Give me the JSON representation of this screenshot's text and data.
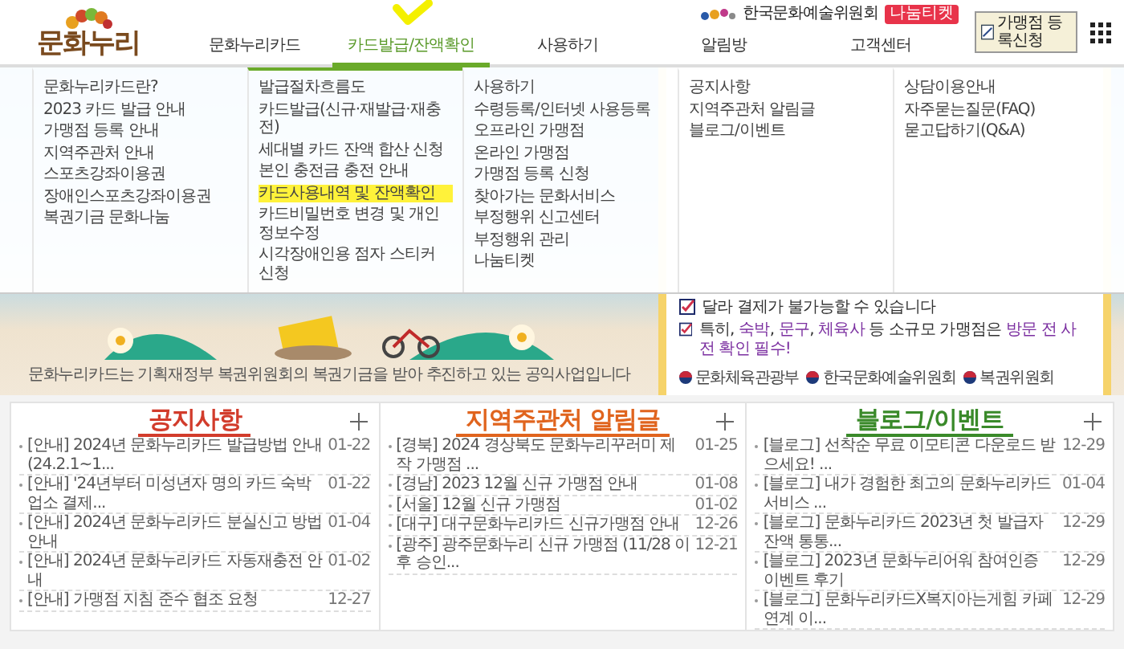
{
  "header": {
    "logo": "문화누리",
    "partner": "한국문화예술위원회",
    "ticket_badge": "나눔티켓",
    "register_button": "가맹점 등록신청",
    "nav": [
      {
        "label": "문화누리카드",
        "selected": false
      },
      {
        "label": "카드발급/잔액확인",
        "selected": true
      },
      {
        "label": "사용하기",
        "selected": false
      },
      {
        "label": "알림방",
        "selected": false
      },
      {
        "label": "고객센터",
        "selected": false
      }
    ]
  },
  "mega_menu": {
    "columns": [
      {
        "items": [
          {
            "label": "문화누리카드란?",
            "highlighted": false
          },
          {
            "label": "2023 카드 발급 안내",
            "highlighted": false
          },
          {
            "label": "가맹점 등록 안내",
            "highlighted": false
          },
          {
            "label": "지역주관처 안내",
            "highlighted": false
          },
          {
            "label": "스포츠강좌이용권",
            "highlighted": false
          },
          {
            "label": "장애인스포츠강좌이용권",
            "highlighted": false
          },
          {
            "label": "복권기금 문화나눔",
            "highlighted": false
          }
        ]
      },
      {
        "items": [
          {
            "label": "발급절차흐름도",
            "highlighted": false
          },
          {
            "label": "카드발급(신규·재발급·재충전)",
            "highlighted": false
          },
          {
            "label": "세대별 카드 잔액 합산 신청",
            "highlighted": false
          },
          {
            "label": "본인 충전금 충전 안내",
            "highlighted": false
          },
          {
            "label": "카드사용내역 및 잔액확인",
            "highlighted": true
          },
          {
            "label": "카드비밀번호 변경 및 개인정보수정",
            "highlighted": false
          },
          {
            "label": "시각장애인용 점자 스티커 신청",
            "highlighted": false
          }
        ]
      },
      {
        "items": [
          {
            "label": "사용하기",
            "highlighted": false
          },
          {
            "label": "수령등록/인터넷 사용등록",
            "highlighted": false
          },
          {
            "label": "오프라인 가맹점",
            "highlighted": false
          },
          {
            "label": "온라인 가맹점",
            "highlighted": false
          },
          {
            "label": "가맹점 등록 신청",
            "highlighted": false
          },
          {
            "label": "찾아가는 문화서비스",
            "highlighted": false
          },
          {
            "label": "부정행위 신고센터",
            "highlighted": false
          },
          {
            "label": "부정행위 관리",
            "highlighted": false
          },
          {
            "label": "나눔티켓",
            "highlighted": false
          }
        ]
      },
      {
        "items": [
          {
            "label": "공지사항",
            "highlighted": false
          },
          {
            "label": "지역주관처 알림글",
            "highlighted": false
          },
          {
            "label": "블로그/이벤트",
            "highlighted": false
          }
        ]
      },
      {
        "items": [
          {
            "label": "상담이용안내",
            "highlighted": false
          },
          {
            "label": "자주묻는질문(FAQ)",
            "highlighted": false
          },
          {
            "label": "묻고답하기(Q&A)",
            "highlighted": false
          }
        ]
      }
    ]
  },
  "banner": {
    "caption": "문화누리카드는 기획재정부 복권위원회의 복권기금을 받아 추진하고 있는 공익사업입니다",
    "notice_items": [
      "달라 결제가 불가능할 수 있습니다",
      "특히, **숙박**, **문구**, **체육사** 등 소규모 가맹점은 **방문 전 사전 확인 필수!**"
    ],
    "logos": [
      "문화체육관광부",
      "한국문화예술위원회",
      "복권위원회"
    ]
  },
  "boards": [
    {
      "title": "공지사항",
      "color": "#d23c2c",
      "rows": [
        {
          "text": "[안내] 2024년 문화누리카드 발급방법 안내(24.2.1~1...",
          "date": "01-22"
        },
        {
          "text": "[안내] '24년부터 미성년자 명의 카드 숙박업소 결제...",
          "date": "01-22"
        },
        {
          "text": "[안내] 2024년 문화누리카드 분실신고 방법 안내",
          "date": "01-04"
        },
        {
          "text": "[안내] 2024년 문화누리카드 자동재충전 안내",
          "date": "01-02"
        },
        {
          "text": "[안내] 가맹점 지침 준수 협조 요청",
          "date": "12-27"
        }
      ]
    },
    {
      "title": "지역주관처 알림글",
      "color": "#e0641e",
      "rows": [
        {
          "text": "[경북] 2024 경상북도 문화누리꾸러미 제작 가맹점 ...",
          "date": "01-25"
        },
        {
          "text": "[경남] 2023 12월 신규 가맹점 안내",
          "date": "01-08"
        },
        {
          "text": "[서울] 12월 신규 가맹점",
          "date": "01-02"
        },
        {
          "text": "[대구] 대구문화누리카드 신규가맹점 안내",
          "date": "12-26"
        },
        {
          "text": "[광주] 광주문화누리 신규 가맹점 (11/28 이후 승인...",
          "date": "12-21"
        }
      ]
    },
    {
      "title": "블로그/이벤트",
      "color": "#3a8a2a",
      "rows": [
        {
          "text": "[블로그] 선착순 무료 이모티콘 다운로드 받으세요! ...",
          "date": "12-29"
        },
        {
          "text": "[블로그] 내가 경험한 최고의 문화누리카드 서비스 ...",
          "date": "01-04"
        },
        {
          "text": "[블로그] 문화누리카드 2023년 첫 발급자 잔액 통통...",
          "date": "12-29"
        },
        {
          "text": "[블로그] 2023년 문화누리어워 참여인증 이벤트 후기",
          "date": "12-29"
        },
        {
          "text": "[블로그] 문화누리카드X복지아는게힘 카페 연계 이...",
          "date": "12-29"
        }
      ]
    }
  ]
}
